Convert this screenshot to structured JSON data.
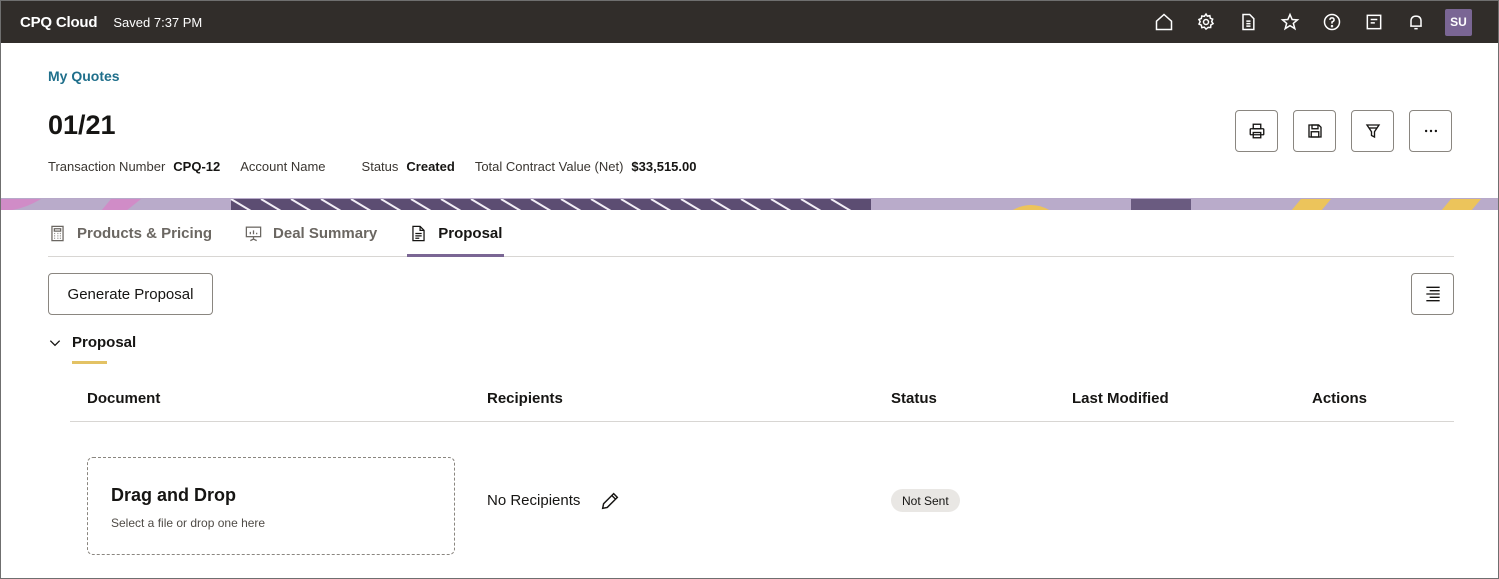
{
  "app": {
    "name": "CPQ Cloud",
    "saved_status": "Saved 7:37 PM"
  },
  "top_icons": [
    "home-icon",
    "settings-icon",
    "report-icon",
    "favorite-icon",
    "help-icon",
    "notes-icon",
    "notifications-icon"
  ],
  "user": {
    "initials": "SU"
  },
  "breadcrumb": "My Quotes",
  "quote": {
    "title": "01/21",
    "transaction_label": "Transaction Number",
    "transaction_value": "CPQ-12",
    "account_label": "Account Name",
    "account_value": "",
    "status_label": "Status",
    "status_value": "Created",
    "tcv_label": "Total Contract Value (Net)",
    "tcv_value": "$33,515.00"
  },
  "header_actions": [
    "print-icon",
    "save-icon",
    "filter-icon",
    "more-icon"
  ],
  "tabs": [
    {
      "label": "Products & Pricing",
      "icon": "calculator-icon",
      "active": false
    },
    {
      "label": "Deal Summary",
      "icon": "presentation-icon",
      "active": false
    },
    {
      "label": "Proposal",
      "icon": "document-icon",
      "active": true
    }
  ],
  "actions": {
    "generate_label": "Generate Proposal"
  },
  "section": {
    "title": "Proposal"
  },
  "table": {
    "columns": [
      "Document",
      "Recipients",
      "Status",
      "Last Modified",
      "Actions"
    ],
    "row": {
      "dropzone_title": "Drag and Drop",
      "dropzone_subtitle": "Select a file or drop one here",
      "recipients": "No Recipients",
      "status": "Not Sent",
      "last_modified": "",
      "actions": ""
    }
  },
  "colors": {
    "topbar": "#312d2a",
    "link": "#1f6f8b",
    "accent": "#7a6694",
    "section_underline": "#e3c264"
  }
}
